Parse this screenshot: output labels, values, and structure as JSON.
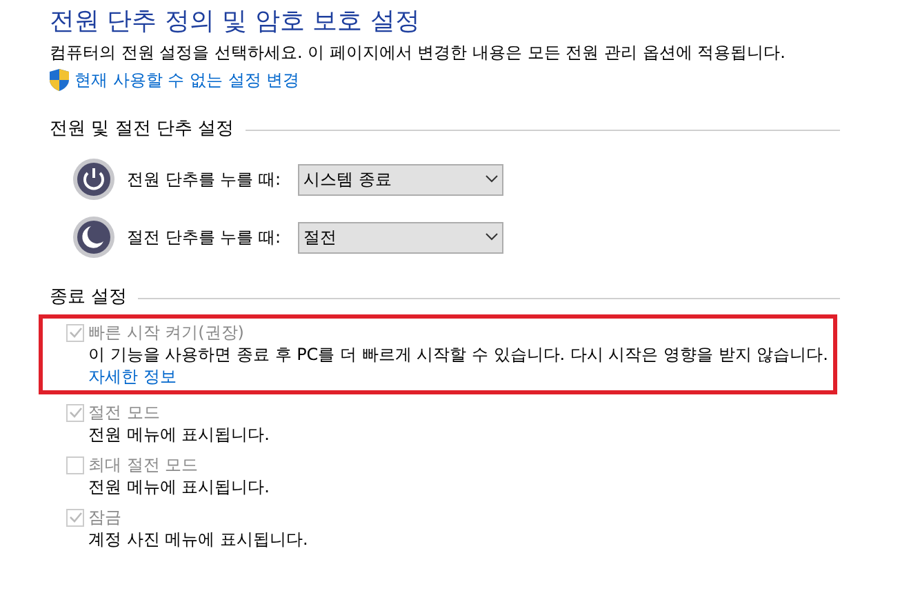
{
  "title": "전원 단추 정의 및 암호 보호 설정",
  "description": "컴퓨터의 전원 설정을 선택하세요. 이 페이지에서 변경한 내용은 모든 전원 관리 옵션에 적용됩니다.",
  "admin_link": "현재 사용할 수 없는 설정 변경",
  "button_section": {
    "heading": "전원 및 절전 단추 설정",
    "rows": [
      {
        "kind": "power",
        "label": "전원 단추를 누를 때:",
        "value": "시스템 종료"
      },
      {
        "kind": "sleep",
        "label": "절전 단추를 누를 때:",
        "value": "절전"
      }
    ]
  },
  "shutdown_section": {
    "heading": "종료 설정",
    "options": [
      {
        "label": "빠른 시작 켜기(권장)",
        "checked": true,
        "disabled": true,
        "highlighted": true,
        "description": "이 기능을 사용하면 종료 후 PC를 더 빠르게 시작할 수 있습니다. 다시 시작은 영향을 받지 않습니다.",
        "link": "자세한 정보"
      },
      {
        "label": "절전 모드",
        "checked": true,
        "disabled": true,
        "highlighted": false,
        "description": "전원 메뉴에 표시됩니다."
      },
      {
        "label": "최대 절전 모드",
        "checked": false,
        "disabled": true,
        "highlighted": false,
        "description": "전원 메뉴에 표시됩니다."
      },
      {
        "label": "잠금",
        "checked": true,
        "disabled": true,
        "highlighted": false,
        "description": "계정 사진 메뉴에 표시됩니다."
      }
    ]
  }
}
